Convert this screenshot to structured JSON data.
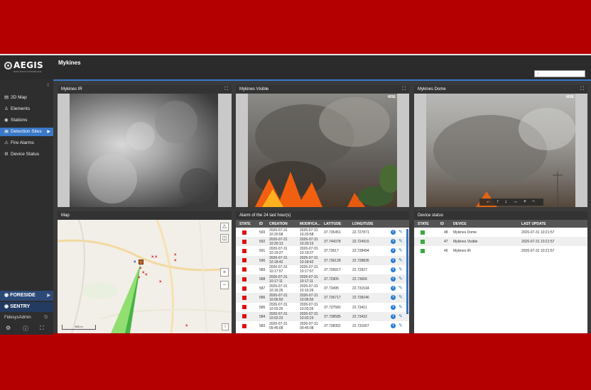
{
  "app": {
    "logo": "AEGIS",
    "logo_sub": "NEO-DATA INTERFACE",
    "page_title": "Mykines",
    "search_placeholder": ""
  },
  "sidebar": {
    "items": [
      {
        "label": "2D Map",
        "icon": "map-icon"
      },
      {
        "label": "Elements",
        "icon": "person-icon"
      },
      {
        "label": "Stations",
        "icon": "radio-icon"
      },
      {
        "label": "Detection Sites",
        "icon": "camera-icon",
        "active": true
      },
      {
        "label": "Fire Alarms",
        "icon": "warning-icon"
      },
      {
        "label": "Device Status",
        "icon": "device-icon"
      }
    ],
    "brands": [
      "FORESIDE",
      "SENTRY"
    ],
    "user": "FidesysAdmin"
  },
  "cameras": [
    {
      "title": "Mykines IR"
    },
    {
      "title": "Mykines Visible",
      "badge": "MSE"
    },
    {
      "title": "Mykines Dome",
      "badge": "MSE",
      "ptz": "← ↑ ↓ → + −"
    }
  ],
  "map": {
    "title": "Map",
    "scale": "500 m"
  },
  "alarms": {
    "title": "Alarm of the 24 last hour(s)",
    "columns": [
      "STATE",
      "ID",
      "CREATION",
      "MODIFICA...",
      "LATITUDE",
      "LONGITUDE"
    ],
    "rows": [
      {
        "id": "593",
        "created": "2026-07-31 10:20:58",
        "modified": "2026-07-31 10:20:58",
        "lat": "37.735451",
        "lon": "22.727871"
      },
      {
        "id": "592",
        "created": "2026-07-31 10:20:13",
        "modified": "2026-07-31 10:20:13",
        "lat": "37.744378",
        "lon": "22.724915"
      },
      {
        "id": "591",
        "created": "2026-07-31 10:19:27",
        "modified": "2026-07-31 10:19:27",
        "lat": "37.73617",
        "lon": "22.728494"
      },
      {
        "id": "590",
        "created": "2026-07-31 10:18:42",
        "modified": "2026-07-31 10:18:42",
        "lat": "37.736128",
        "lon": "22.728835"
      },
      {
        "id": "589",
        "created": "2026-07-31 10:17:57",
        "modified": "2026-07-31 10:17:57",
        "lat": "37.735917",
        "lon": "22.72927"
      },
      {
        "id": "588",
        "created": "2026-07-31 10:17:11",
        "modified": "2026-07-31 10:17:11",
        "lat": "37.72905",
        "lon": "22.73606"
      },
      {
        "id": "587",
        "created": "2026-07-31 10:16:26",
        "modified": "2026-07-31 10:16:26",
        "lat": "37.73495",
        "lon": "22.731534"
      },
      {
        "id": "586",
        "created": "2026-07-31 10:06:50",
        "modified": "2026-07-31 10:06:50",
        "lat": "37.736717",
        "lon": "22.728246"
      },
      {
        "id": "585",
        "created": "2026-07-31 10:03:26",
        "modified": "2026-07-31 10:03:26",
        "lat": "37.737582",
        "lon": "22.73411"
      },
      {
        "id": "584",
        "created": "2026-07-31 10:02:23",
        "modified": "2026-07-31 10:02:23",
        "lat": "37.738585",
        "lon": "22.73432"
      },
      {
        "id": "583",
        "created": "2026-07-31 09:45:08",
        "modified": "2026-07-31 09:45:08",
        "lat": "37.738352",
        "lon": "22.731067"
      }
    ]
  },
  "devices": {
    "title": "Device status",
    "columns": [
      "STATE",
      "ID",
      "DEVICE",
      "LAST UPDATE"
    ],
    "rows": [
      {
        "id": "48",
        "name": "Mykines Dome",
        "updated": "2026-07-31 10:21:57"
      },
      {
        "id": "47",
        "name": "Mykines Visible",
        "updated": "2026-07-31 10:21:57"
      },
      {
        "id": "46",
        "name": "Mykines IR",
        "updated": "2026-07-31 10:21:57"
      }
    ]
  },
  "colors": {
    "accent": "#3a78c8",
    "alarm": "#dd1111",
    "ok": "#3caa3c",
    "frame": "#b40000"
  }
}
